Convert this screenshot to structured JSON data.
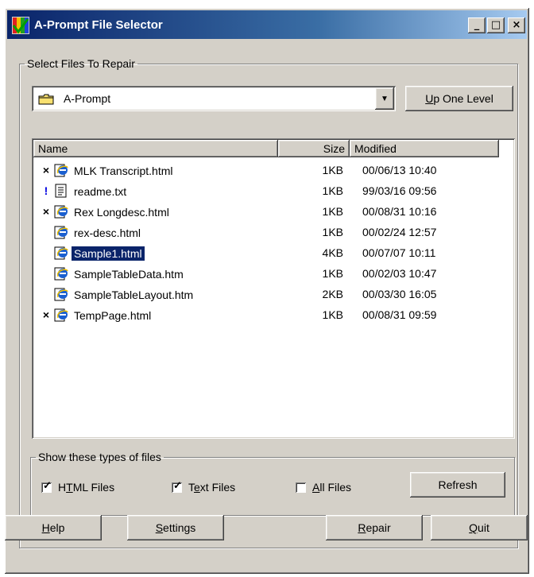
{
  "window": {
    "title": "A-Prompt File Selector",
    "controls": {
      "minimize": "_",
      "maximize": "□",
      "close": "×"
    }
  },
  "select_group": {
    "legend": "Select Files To Repair",
    "folder": {
      "value": "A-Prompt",
      "icon": "folder-icon"
    },
    "up_one_level": {
      "pre": "",
      "key": "U",
      "post": "p One Level"
    }
  },
  "file_list": {
    "columns": [
      "Name",
      "Size",
      "Modified"
    ],
    "rows": [
      {
        "mark": "×",
        "icon": "ie-html-icon",
        "name": "MLK Transcript.html",
        "size": "1KB",
        "modified": "00/06/13 10:40"
      },
      {
        "mark": "!",
        "icon": "text-file-icon",
        "name": "readme.txt",
        "size": "1KB",
        "modified": "99/03/16 09:56"
      },
      {
        "mark": "×",
        "icon": "ie-html-icon",
        "name": "Rex Longdesc.html",
        "size": "1KB",
        "modified": "00/08/31 10:16"
      },
      {
        "mark": "",
        "icon": "ie-html-icon",
        "name": "rex-desc.html",
        "size": "1KB",
        "modified": "00/02/24 12:57"
      },
      {
        "mark": "",
        "icon": "ie-html-icon",
        "name": "Sample1.html",
        "size": "4KB",
        "modified": "00/07/07 10:11"
      },
      {
        "mark": "",
        "icon": "ie-html-icon",
        "name": "SampleTableData.htm",
        "size": "1KB",
        "modified": "00/02/03 10:47"
      },
      {
        "mark": "",
        "icon": "ie-html-icon",
        "name": "SampleTableLayout.htm",
        "size": "2KB",
        "modified": "00/03/30 16:05"
      },
      {
        "mark": "×",
        "icon": "ie-html-icon",
        "name": "TempPage.html",
        "size": "1KB",
        "modified": "00/08/31 09:59"
      }
    ],
    "selected_name": "Sample1.html"
  },
  "filter_group": {
    "legend": "Show these types of files",
    "html_files": {
      "pre": "H",
      "key": "T",
      "post": "ML Files",
      "checked": true
    },
    "text_files": {
      "pre": "T",
      "key": "e",
      "post": "xt Files",
      "checked": true
    },
    "all_files": {
      "pre": "",
      "key": "A",
      "post": "ll Files",
      "checked": false
    },
    "refresh": "Refresh"
  },
  "footer": {
    "help": {
      "pre": "",
      "key": "H",
      "post": "elp"
    },
    "settings": {
      "pre": "",
      "key": "S",
      "post": "ettings"
    },
    "repair": {
      "pre": "",
      "key": "R",
      "post": "epair"
    },
    "quit": {
      "pre": "",
      "key": "Q",
      "post": "uit"
    }
  },
  "colors": {
    "selection": "#0a246a",
    "face": "#d4d0c8",
    "title_start": "#0a246a",
    "title_end": "#a6caf0"
  }
}
